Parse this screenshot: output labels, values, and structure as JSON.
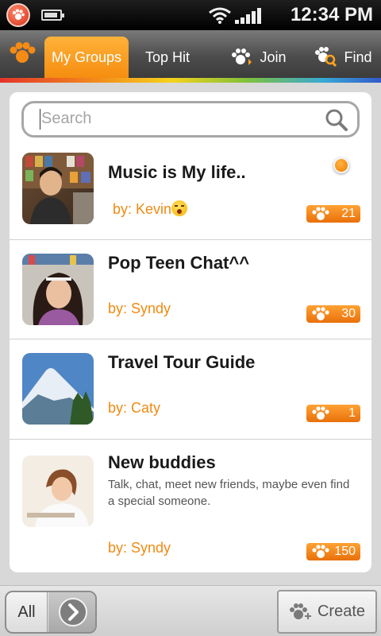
{
  "status_bar": {
    "time": "12:34 PM"
  },
  "tabs": [
    {
      "label": "My Groups",
      "active": true
    },
    {
      "label": "Top Hit",
      "active": false
    },
    {
      "label": "Join",
      "active": false
    },
    {
      "label": "Find",
      "active": false
    }
  ],
  "search": {
    "placeholder": "Search",
    "value": ""
  },
  "groups": [
    {
      "title": "Music  is My life..",
      "by": "by: Kevin",
      "members": "21",
      "online": true,
      "emoji": "surprised-face"
    },
    {
      "title": "Pop Teen Chat^^",
      "by": "by: Syndy",
      "members": "30"
    },
    {
      "title": "Travel Tour Guide",
      "by": "by: Caty",
      "members": "1"
    },
    {
      "title": "New buddies",
      "description": "Talk, chat, meet new friends, maybe even find a special someone.",
      "by": "by: Syndy",
      "members": "150"
    }
  ],
  "bottom_bar": {
    "filter_label": "All",
    "create_label": "Create"
  },
  "colors": {
    "accent": "#f58d10",
    "text": "#1a1a1a",
    "by_text": "#ef8a12"
  }
}
